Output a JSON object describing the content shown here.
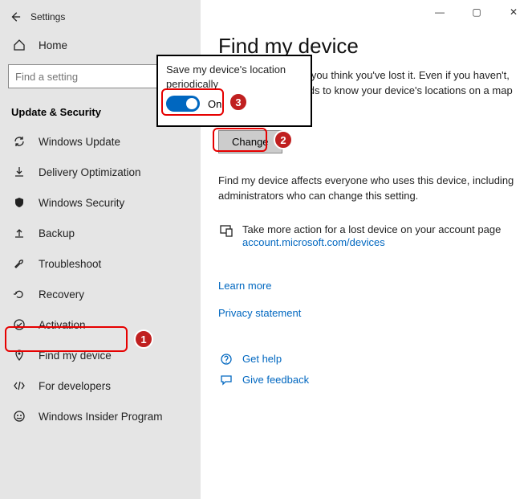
{
  "window": {
    "title": "Settings",
    "min": "—",
    "max": "▢",
    "close": "✕"
  },
  "sidebar": {
    "home_label": "Home",
    "search_placeholder": "Find a setting",
    "section_title": "Update & Security",
    "items": [
      {
        "label": "Windows Update"
      },
      {
        "label": "Delivery Optimization"
      },
      {
        "label": "Windows Security"
      },
      {
        "label": "Backup"
      },
      {
        "label": "Troubleshoot"
      },
      {
        "label": "Recovery"
      },
      {
        "label": "Activation"
      },
      {
        "label": "Find my device"
      },
      {
        "label": "For developers"
      },
      {
        "label": "Windows Insider Program"
      }
    ]
  },
  "main": {
    "heading": "Find my device",
    "intro": "Track your device if you think you've lost it. Even if you haven't, Find my device needs to know your device's locations on a map to help you",
    "change_btn": "Change",
    "affects_text": "Find my device affects everyone who uses this device, including administrators who can change this setting.",
    "account_action": "Take more action for a lost device on your account page",
    "account_link": "account.microsoft.com/devices",
    "learn_more": "Learn more",
    "privacy": "Privacy statement",
    "get_help": "Get help",
    "give_feedback": "Give feedback"
  },
  "popup": {
    "title": "Save my device's location periodically",
    "toggle_label": "On",
    "toggle_state": true
  },
  "annotations": {
    "b1": "1",
    "b2": "2",
    "b3": "3"
  }
}
